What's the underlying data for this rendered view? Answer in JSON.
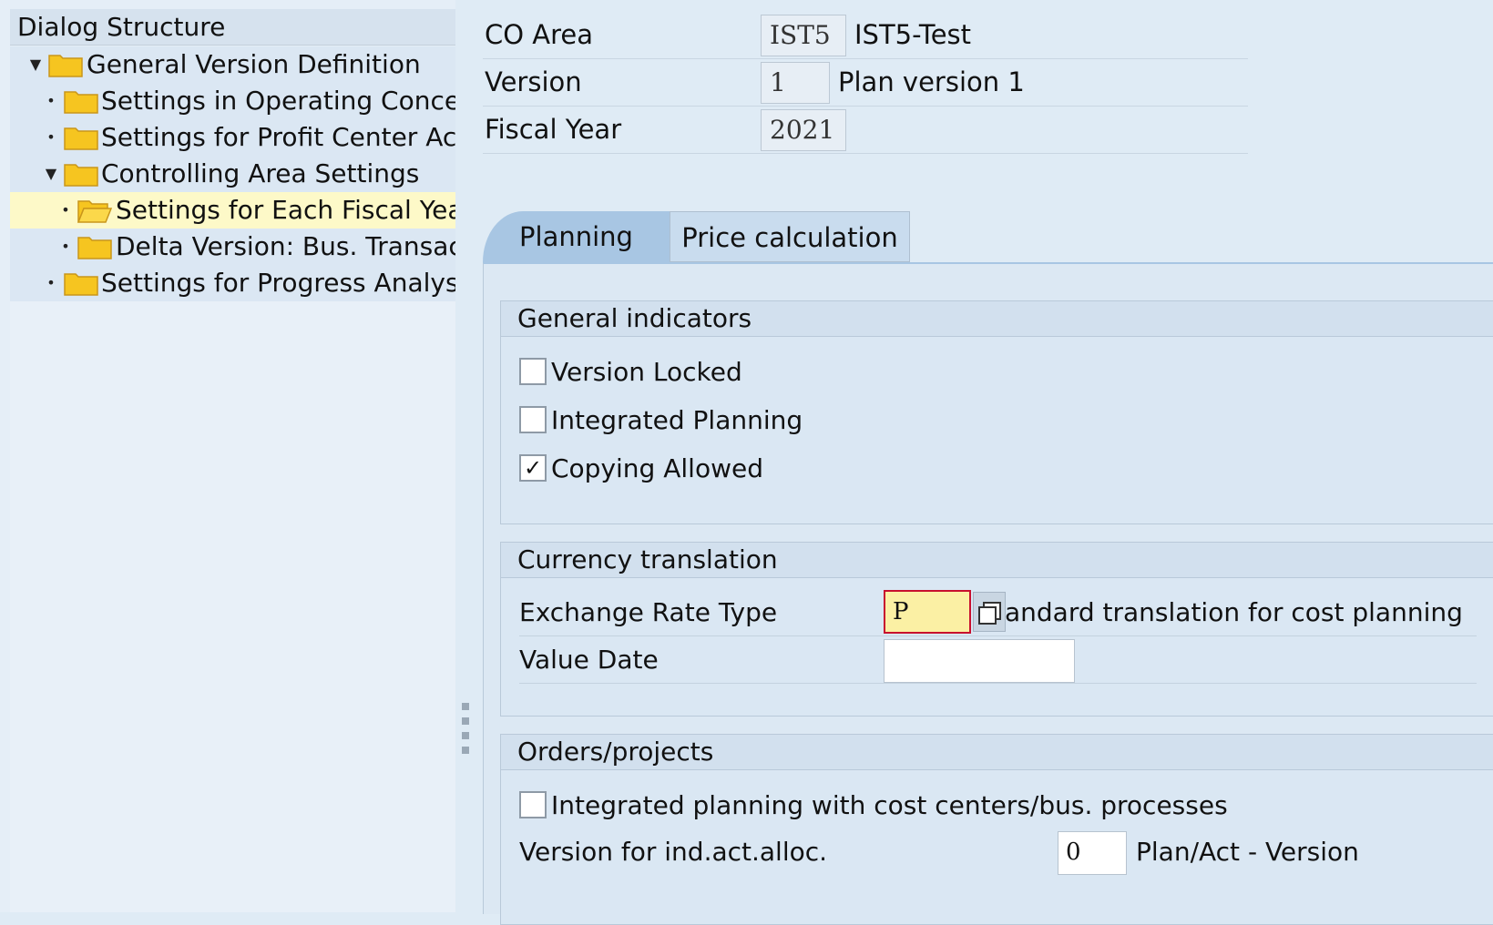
{
  "tree": {
    "header": "Dialog Structure",
    "items": [
      {
        "label": "General Version Definition",
        "expanded": true
      },
      {
        "label": "Settings in Operating Concern"
      },
      {
        "label": "Settings for Profit Center Accounting"
      },
      {
        "label": "Controlling Area Settings",
        "expanded": true
      },
      {
        "label": "Settings for Each Fiscal Year",
        "selected": true
      },
      {
        "label": "Delta Version: Bus. Transactions"
      },
      {
        "label": "Settings for Progress Analysis"
      }
    ]
  },
  "header": {
    "co_area": {
      "label": "CO Area",
      "value": "IST5",
      "desc": "IST5-Test"
    },
    "version": {
      "label": "Version",
      "value": "1",
      "desc": "Plan version 1"
    },
    "fiscal_year": {
      "label": "Fiscal Year",
      "value": "2021"
    }
  },
  "tabs": [
    {
      "label": "Planning",
      "active": true
    },
    {
      "label": "Price calculation",
      "active": false
    }
  ],
  "general_indicators": {
    "title": "General indicators",
    "version_locked": {
      "label": "Version Locked",
      "checked": false
    },
    "integrated_planning": {
      "label": "Integrated Planning",
      "checked": false
    },
    "copying_allowed": {
      "label": "Copying Allowed",
      "checked": true,
      "mark": "✓"
    }
  },
  "currency_translation": {
    "title": "Currency translation",
    "exchange_rate_type": {
      "label": "Exchange Rate Type",
      "value": "P",
      "desc": "andard translation for cost planning"
    },
    "value_date": {
      "label": "Value Date",
      "value": ""
    }
  },
  "orders_projects": {
    "title": "Orders/projects",
    "integrated_planning_cc": {
      "label": "Integrated planning with cost centers/bus. processes",
      "checked": false
    },
    "version_ind_act_alloc": {
      "label": "Version for ind.act.alloc.",
      "value": "0",
      "desc": "Plan/Act - Version"
    }
  },
  "colors": {
    "background": "#dfebf5",
    "selected_row": "#fdf9c8",
    "required_field": "#fbf0a4",
    "tab_active": "#a8c6e3",
    "folder": "#f6c520"
  }
}
